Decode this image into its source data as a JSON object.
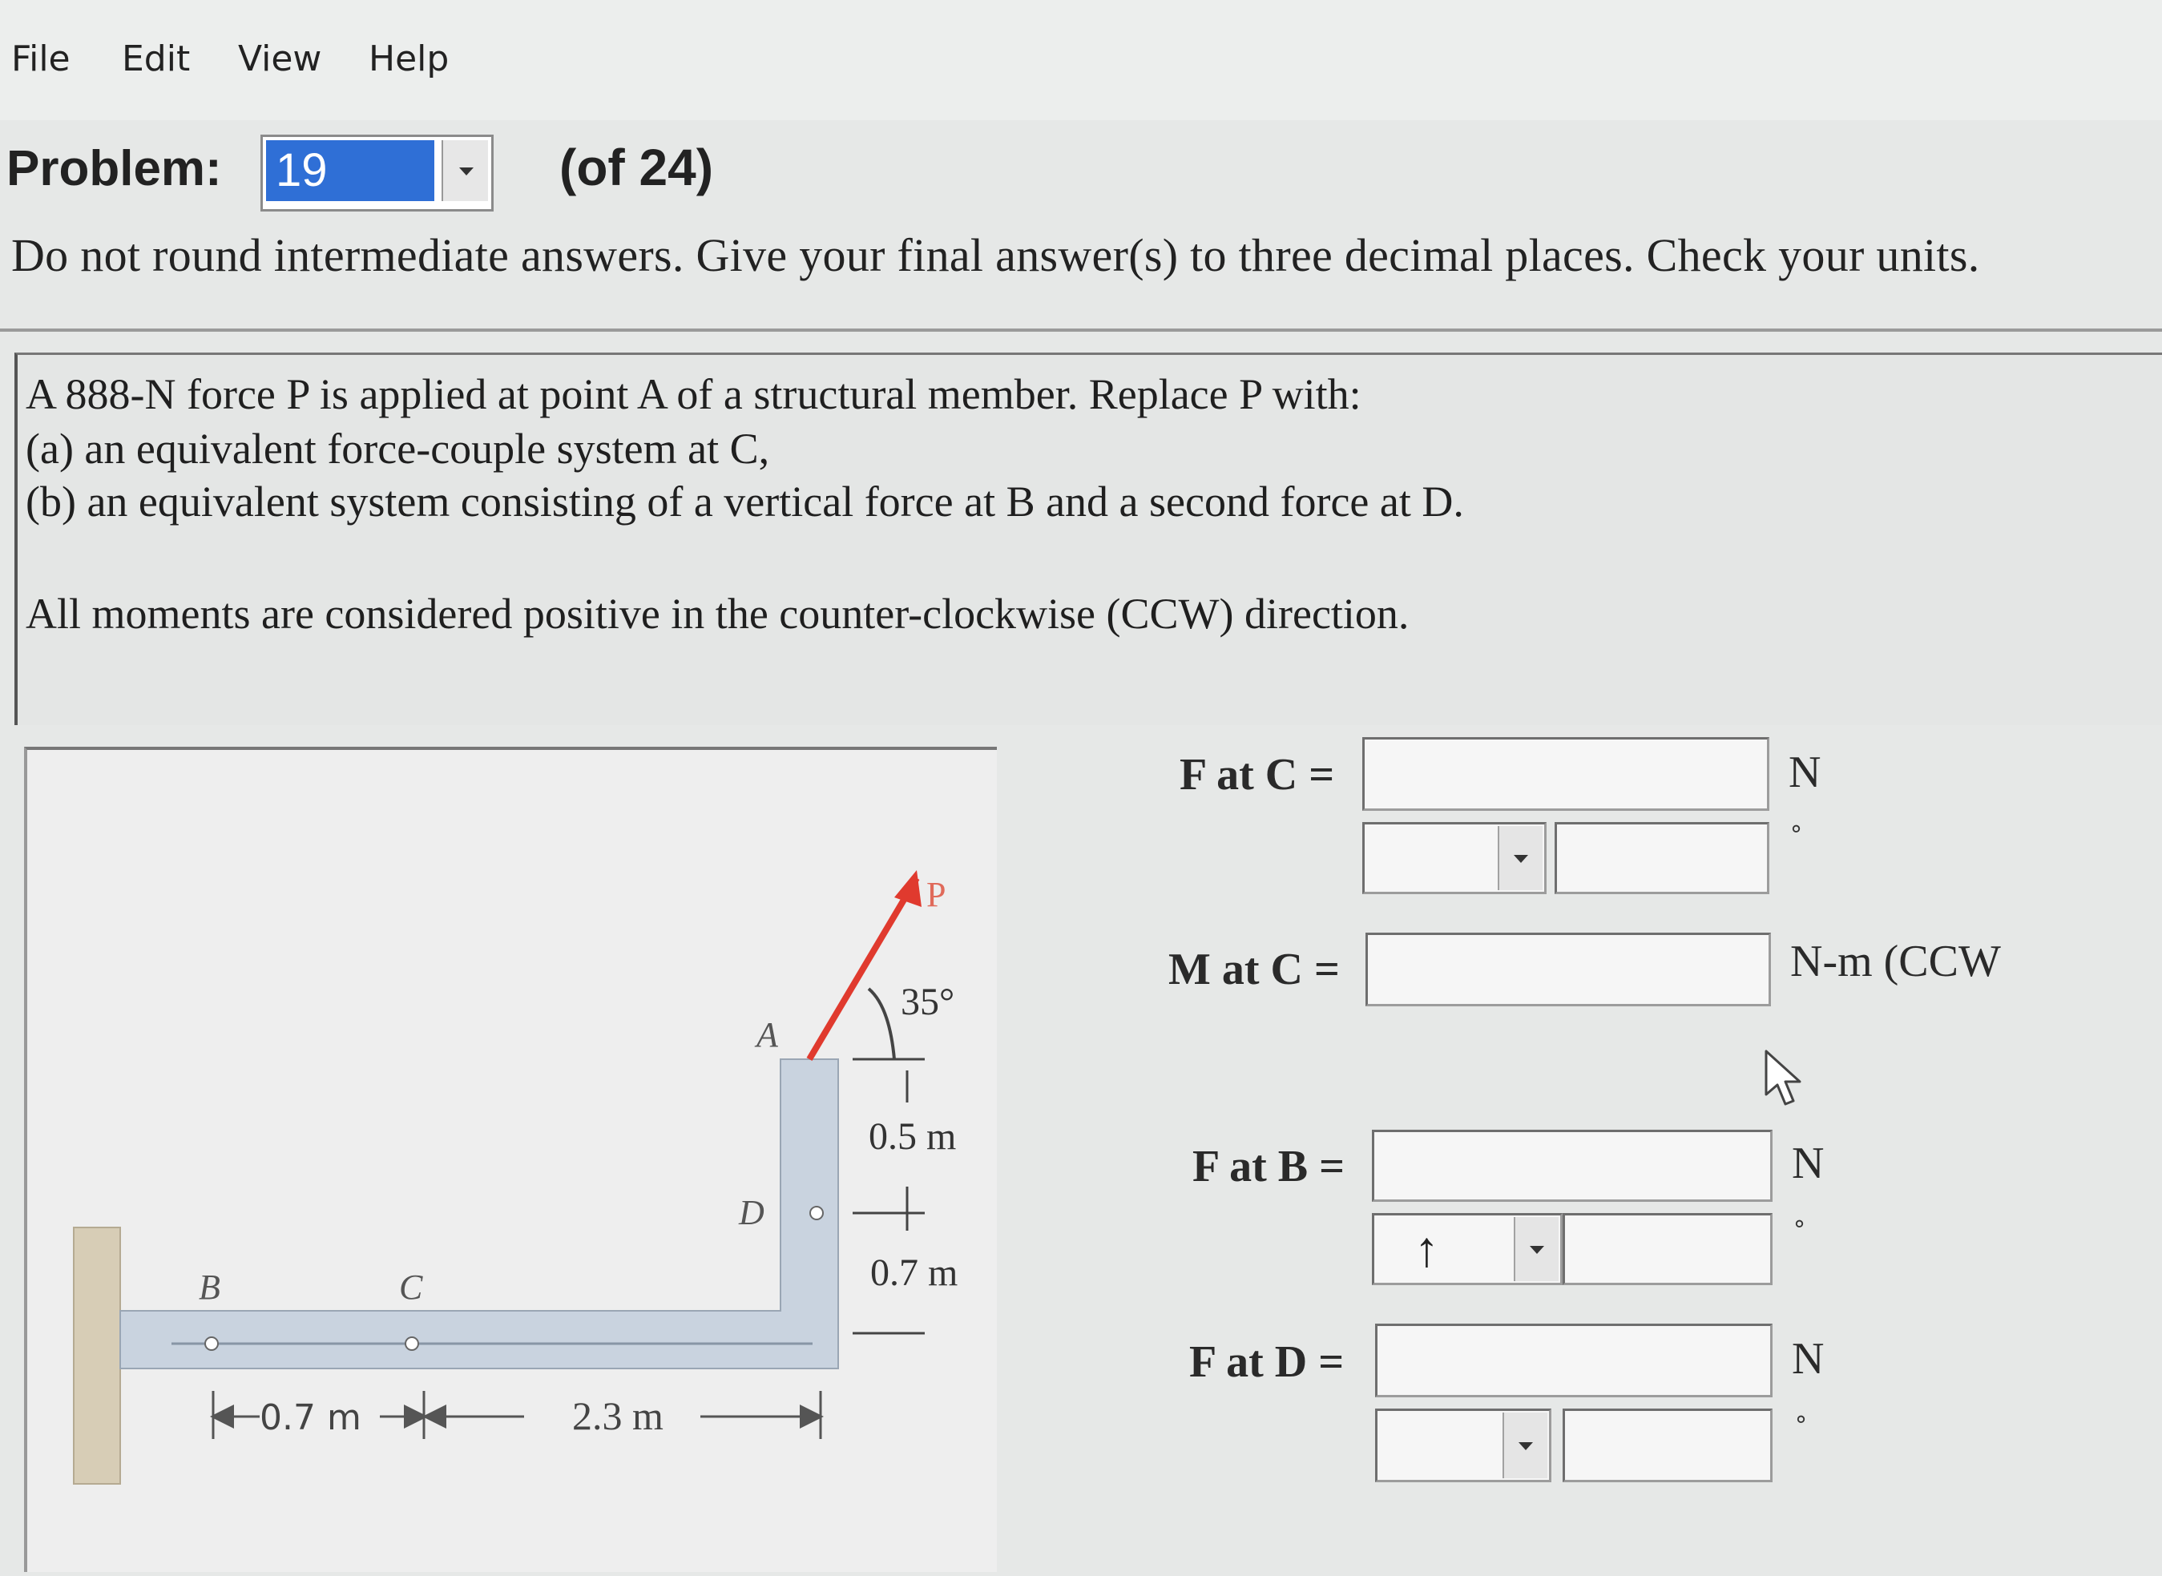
{
  "menu": [
    "File",
    "Edit",
    "View",
    "Help"
  ],
  "problem": {
    "label": "Problem:",
    "selected": "19",
    "of_count": "(of 24)"
  },
  "instructions": "Do not round intermediate answers. Give your final answer(s) to three decimal places. Check your units.",
  "statement": {
    "line1": "A 888-N force P is applied at point A of a structural member. Replace P with:",
    "line2": "(a) an equivalent force-couple system at C,",
    "line3": "(b) an equivalent system consisting of a vertical force at B and a second force at D.",
    "line4": "All moments are considered positive in the counter-clockwise (CCW) direction."
  },
  "figure": {
    "label_P": "P",
    "label_A": "A",
    "label_B": "B",
    "label_C": "C",
    "label_D": "D",
    "angle": "35°",
    "dim_05": "0.5 m",
    "dim_07_right": "0.7 m",
    "dim_07_bottom": "0.7 m",
    "dim_23": "2.3 m"
  },
  "answers": {
    "f_at_c": {
      "label": "F at C =",
      "unit": "N",
      "deg": "°",
      "value": "",
      "direction": "",
      "angle": ""
    },
    "m_at_c": {
      "label": "M at C =",
      "unit": "N-m (CCW",
      "value": ""
    },
    "f_at_b": {
      "label": "F at B =",
      "unit": "N",
      "deg": "°",
      "value": "",
      "direction": "↑",
      "angle": ""
    },
    "f_at_d": {
      "label": "F at D =",
      "unit": "N",
      "deg": "°",
      "value": "",
      "direction": "",
      "angle": ""
    }
  },
  "colors": {
    "select_highlight": "#2f6fd6",
    "force_arrow": "#e03a2e",
    "member_fill": "#c9d3df",
    "wall_fill": "#d7cdb6"
  }
}
